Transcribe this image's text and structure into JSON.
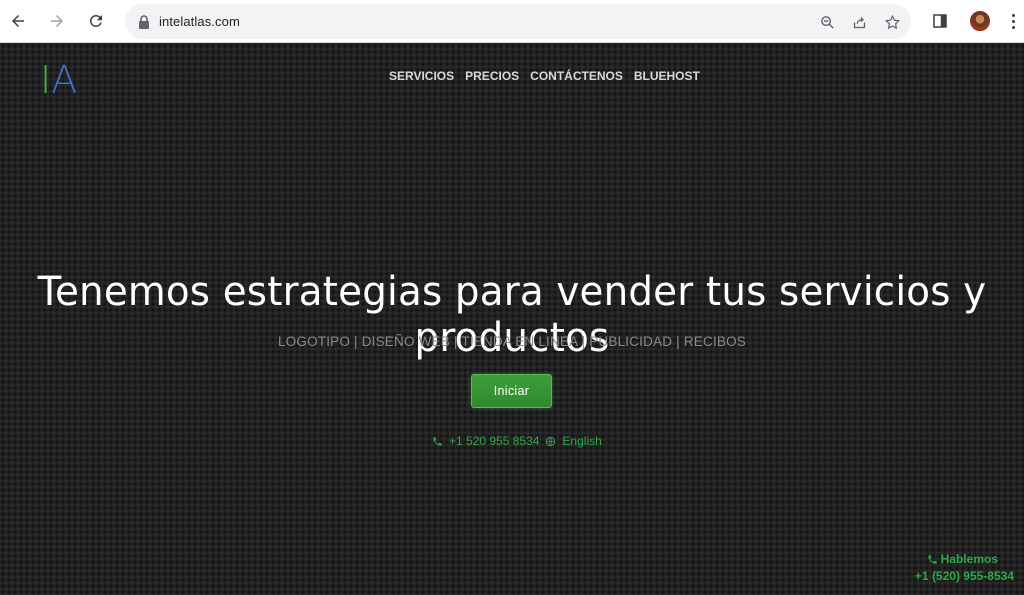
{
  "browser": {
    "url": "intelatlas.com",
    "icons": [
      "back-icon",
      "forward-icon",
      "reload-icon",
      "lock-icon",
      "zoom-icon",
      "share-icon",
      "bookmark-star-icon",
      "side-panel-icon",
      "profile-avatar",
      "menu-kebab-icon"
    ]
  },
  "site": {
    "logo_i": "I",
    "logo_a": "A",
    "nav": [
      "SERVICIOS",
      "PRECIOS",
      "CONTÁCTENOS",
      "BLUEHOST"
    ],
    "hero_title": "Tenemos estrategias para vender tus servicios y productos",
    "hero_subtitle": "LOGOTIPO | DISEÑO WEB | TIENDA EN LINEA | PUBLICIDAD | RECIBOS",
    "cta_label": "Iniciar",
    "phone": "+1 520 955 8534",
    "language": "English",
    "float_label": "Hablemos",
    "float_phone": "+1 (520) 955-8534"
  },
  "colors": {
    "accent_green": "#2ea84a",
    "logo_green": "#3fb34a",
    "logo_blue": "#3e6fc9",
    "background": "#232323"
  }
}
